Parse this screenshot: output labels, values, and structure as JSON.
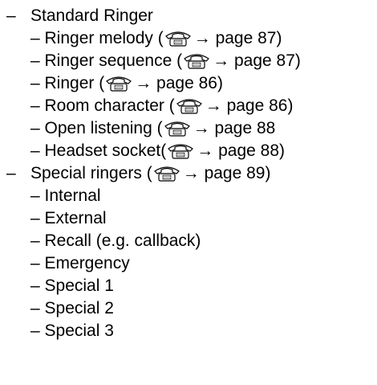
{
  "items": [
    {
      "text": "Standard Ringer"
    },
    {
      "pre": "– Ringer melody (",
      "post": "→ page 87)"
    },
    {
      "pre": "– Ringer sequence (",
      "post": "→ page 87)"
    },
    {
      "pre": "– Ringer (",
      "post": "→ page 86)"
    },
    {
      "pre": "– Room character (",
      "post": "→ page 86)"
    },
    {
      "pre": "– Open listening (",
      "post": "→ page 88"
    },
    {
      "pre": "– Headset socket(",
      "post": "→ page 88)"
    },
    {
      "pre": "Special ringers (",
      "post": "→ page 89)"
    },
    {
      "text": "– Internal"
    },
    {
      "text": "– External"
    },
    {
      "text": "– Recall (e.g. callback)"
    },
    {
      "text": "– Emergency"
    },
    {
      "text": "– Special 1"
    },
    {
      "text": "– Special 2"
    },
    {
      "text": "– Special 3"
    }
  ],
  "bullet": "–",
  "icon": "phone-icon"
}
